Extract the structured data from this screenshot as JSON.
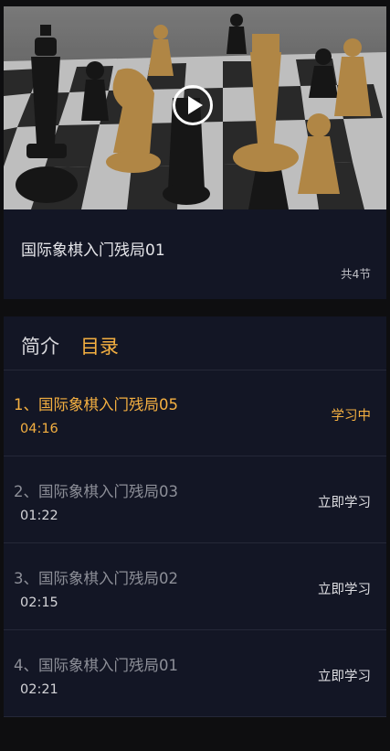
{
  "course": {
    "title": "国际象棋入门残局01",
    "lesson_count": "共4节"
  },
  "tabs": {
    "intro_label": "简介",
    "catalog_label": "目录"
  },
  "lessons": [
    {
      "title": "1、国际象棋入门残局05",
      "duration": "04:16",
      "status": "学习中",
      "active": true
    },
    {
      "title": "2、国际象棋入门残局03",
      "duration": "01:22",
      "status": "立即学习",
      "active": false
    },
    {
      "title": "3、国际象棋入门残局02",
      "duration": "02:15",
      "status": "立即学习",
      "active": false
    },
    {
      "title": "4、国际象棋入门残局01",
      "duration": "02:21",
      "status": "立即学习",
      "active": false
    }
  ],
  "colors": {
    "accent": "#f5b041",
    "panel": "#131625",
    "background": "#0e0e10"
  }
}
